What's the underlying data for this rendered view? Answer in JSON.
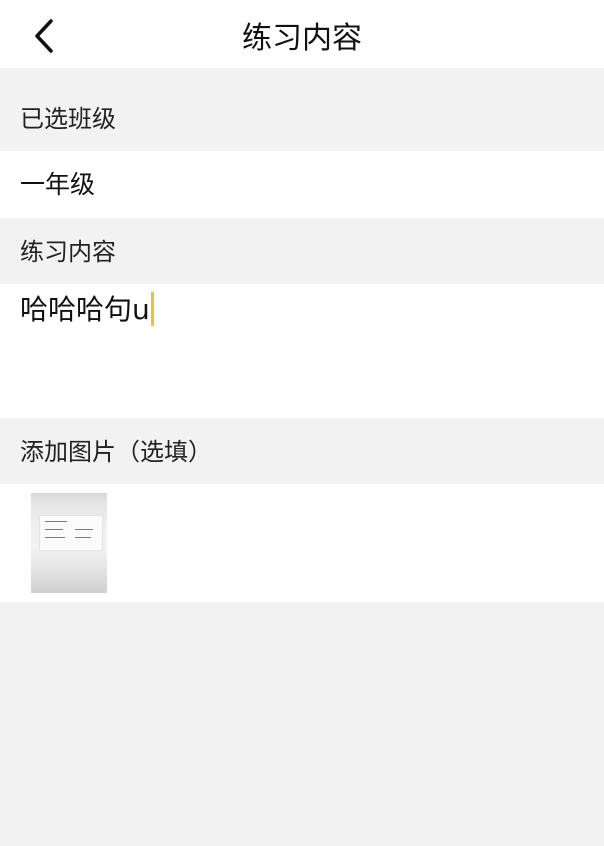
{
  "header": {
    "title": "练习内容"
  },
  "sections": {
    "selected_class_label": "已选班级",
    "selected_class_value": "一年级",
    "content_label": "练习内容",
    "content_value": "哈哈哈句u",
    "images_label": "添加图片（选填）"
  },
  "icons": {
    "back": "chevron-left-icon",
    "caret_color": "#f0c030"
  },
  "colors": {
    "background": "#f2f2f2",
    "surface": "#ffffff",
    "text": "#111111"
  }
}
